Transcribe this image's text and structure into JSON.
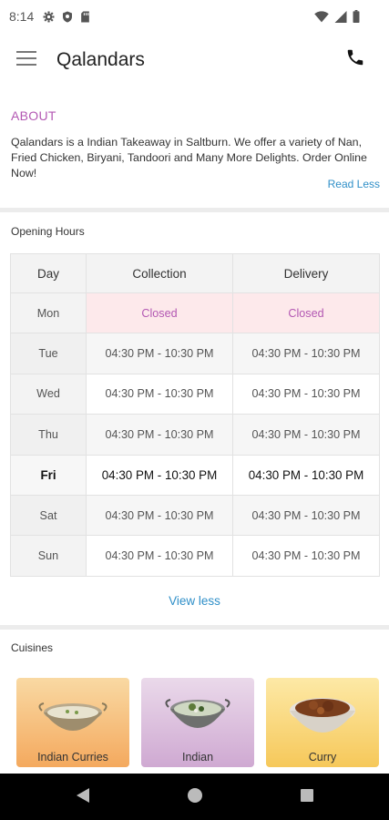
{
  "status_bar": {
    "time": "8:14",
    "icons_left": [
      "gear-icon",
      "shield-icon",
      "sd-card-icon"
    ],
    "icons_right": [
      "wifi-icon",
      "cell-signal-icon",
      "battery-icon"
    ]
  },
  "app_bar": {
    "title": "Qalandars",
    "menu_icon": "hamburger-menu-icon",
    "phone_icon": "phone-icon"
  },
  "about": {
    "heading": "ABOUT",
    "text": "Qalandars is a Indian Takeaway in Saltburn. We offer a variety of Nan, Fried Chicken, Biryani, Tandoori and Many More Delights. Order Online Now!",
    "read_less": "Read Less"
  },
  "opening_hours": {
    "heading": "Opening Hours",
    "columns": [
      "Day",
      "Collection",
      "Delivery"
    ],
    "rows": [
      {
        "day": "Mon",
        "collection": "Closed",
        "delivery": "Closed"
      },
      {
        "day": "Tue",
        "collection": "04:30 PM - 10:30 PM",
        "delivery": "04:30 PM - 10:30 PM"
      },
      {
        "day": "Wed",
        "collection": "04:30 PM - 10:30 PM",
        "delivery": "04:30 PM - 10:30 PM"
      },
      {
        "day": "Thu",
        "collection": "04:30 PM - 10:30 PM",
        "delivery": "04:30 PM - 10:30 PM"
      },
      {
        "day": "Fri",
        "collection": "04:30 PM - 10:30 PM",
        "delivery": "04:30 PM - 10:30 PM"
      },
      {
        "day": "Sat",
        "collection": "04:30 PM - 10:30 PM",
        "delivery": "04:30 PM - 10:30 PM"
      },
      {
        "day": "Sun",
        "collection": "04:30 PM - 10:30 PM",
        "delivery": "04:30 PM - 10:30 PM"
      }
    ],
    "view_less": "View less"
  },
  "cuisines": {
    "heading": "Cuisines",
    "items": [
      {
        "label": "Indian Curries"
      },
      {
        "label": "Indian"
      },
      {
        "label": "Curry"
      }
    ]
  },
  "colors": {
    "accent_purple": "#b358b3",
    "link_blue": "#2f8fc8",
    "closed_bg": "#fde9eb"
  }
}
